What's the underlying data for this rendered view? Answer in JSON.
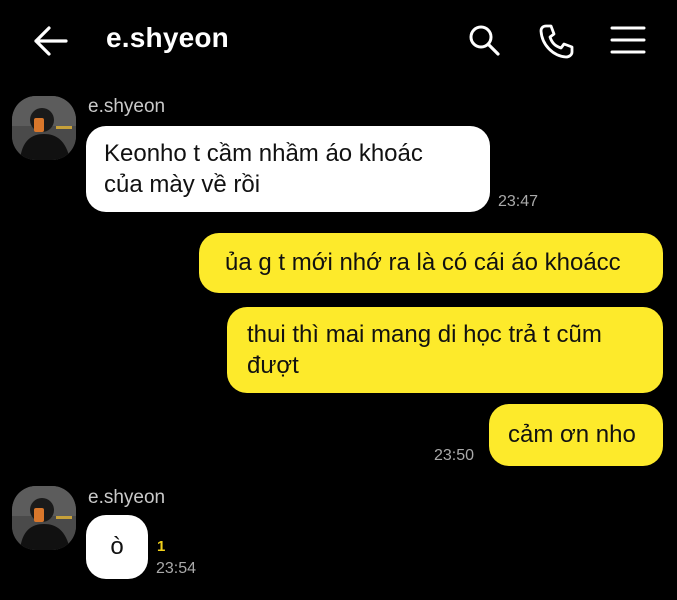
{
  "header": {
    "title": "e.shyeon",
    "back_icon": "arrow-left-icon",
    "search_icon": "search-icon",
    "call_icon": "phone-icon",
    "menu_icon": "menu-icon"
  },
  "colors": {
    "background": "#000000",
    "incoming_bubble": "#ffffff",
    "outgoing_bubble": "#fdea2b",
    "unread_count": "#f2d11b"
  },
  "messages": [
    {
      "sender": "e.shyeon",
      "text": "Keonho t cầm nhầm áo khoác\ncủa mày về rồi",
      "time": "23:47",
      "direction": "incoming"
    },
    {
      "text": "ủa g t mới nhớ ra là có cái áo khoácc",
      "direction": "outgoing"
    },
    {
      "text": "thui thì mai mang di học trả t cũm\nđượt",
      "direction": "outgoing"
    },
    {
      "text": "cảm ơn nho",
      "time": "23:50",
      "direction": "outgoing"
    },
    {
      "sender": "e.shyeon",
      "text": "ò",
      "time": "23:54",
      "unread": "1",
      "direction": "incoming"
    }
  ]
}
